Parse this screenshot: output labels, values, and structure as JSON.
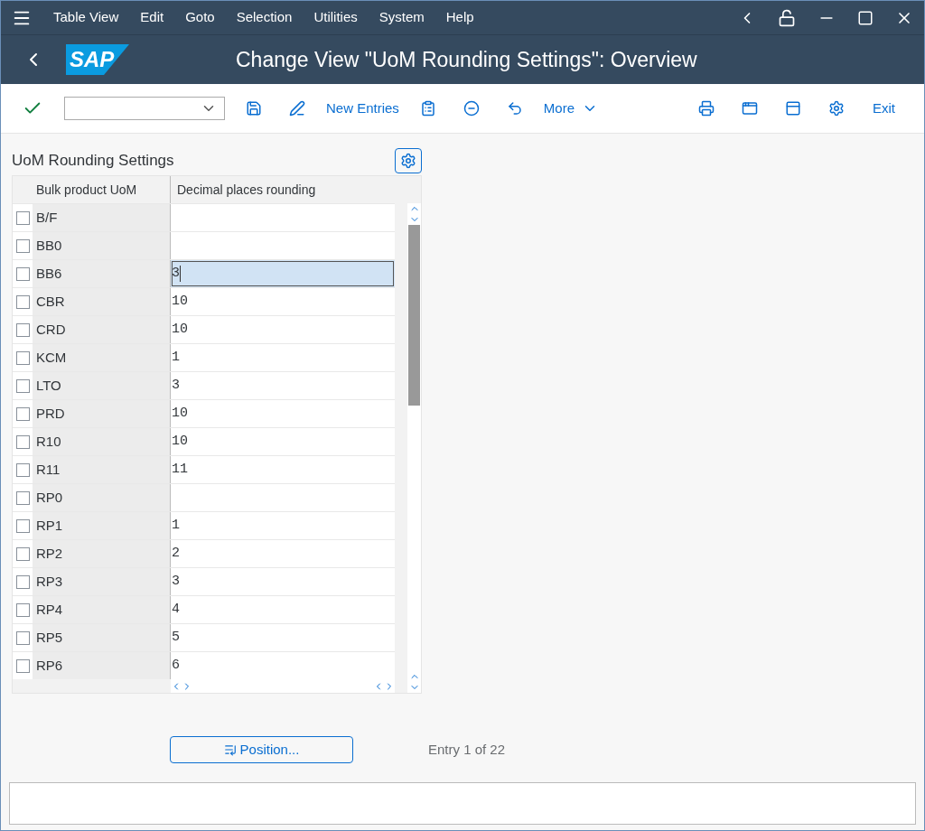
{
  "menu": [
    "Table View",
    "Edit",
    "Goto",
    "Selection",
    "Utilities",
    "System",
    "Help"
  ],
  "title": "Change View \"UoM Rounding Settings\": Overview",
  "logo": "SAP",
  "toolbar": {
    "new_entries": "New Entries",
    "more": "More",
    "exit": "Exit"
  },
  "table": {
    "title": "UoM Rounding Settings",
    "columns": [
      "Bulk product UoM",
      "Decimal places rounding"
    ],
    "rows": [
      {
        "key": "B/F",
        "value": "",
        "checked": false,
        "focused": false
      },
      {
        "key": "BB0",
        "value": "",
        "checked": false,
        "focused": false
      },
      {
        "key": "BB6",
        "value": "3",
        "checked": false,
        "focused": true
      },
      {
        "key": "CBR",
        "value": "10",
        "checked": false,
        "focused": false
      },
      {
        "key": "CRD",
        "value": "10",
        "checked": false,
        "focused": false
      },
      {
        "key": "KCM",
        "value": "1",
        "checked": false,
        "focused": false
      },
      {
        "key": "LTO",
        "value": "3",
        "checked": false,
        "focused": false
      },
      {
        "key": "PRD",
        "value": "10",
        "checked": false,
        "focused": false
      },
      {
        "key": "R10",
        "value": "10",
        "checked": false,
        "focused": false
      },
      {
        "key": "R11",
        "value": "11",
        "checked": false,
        "focused": false
      },
      {
        "key": "RP0",
        "value": "",
        "checked": false,
        "focused": false
      },
      {
        "key": "RP1",
        "value": "1",
        "checked": false,
        "focused": false
      },
      {
        "key": "RP2",
        "value": "2",
        "checked": false,
        "focused": false
      },
      {
        "key": "RP3",
        "value": "3",
        "checked": false,
        "focused": false
      },
      {
        "key": "RP4",
        "value": "4",
        "checked": false,
        "focused": false
      },
      {
        "key": "RP5",
        "value": "5",
        "checked": false,
        "focused": false
      },
      {
        "key": "RP6",
        "value": "6",
        "checked": false,
        "focused": false
      }
    ]
  },
  "position_button": "Position...",
  "entry_count": "Entry 1 of 22"
}
